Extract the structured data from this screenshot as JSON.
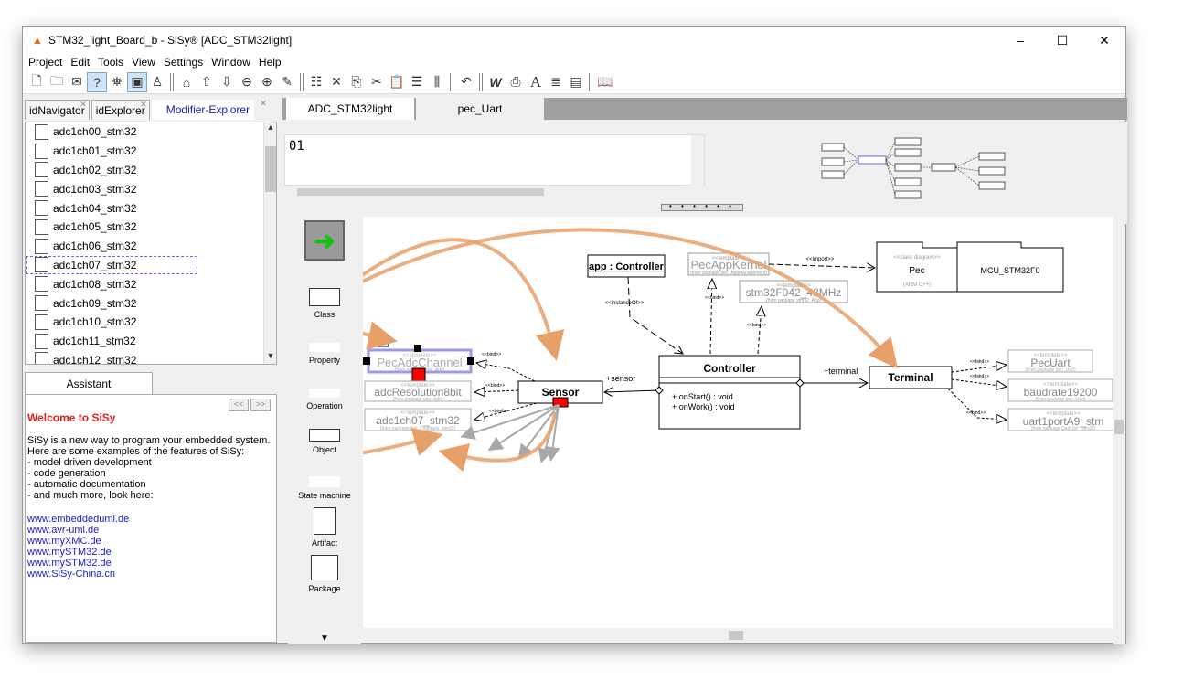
{
  "window": {
    "title": "STM32_light_Board_b - SiSy® [ADC_STM32light]"
  },
  "menu": [
    "Project",
    "Edit",
    "Tools",
    "View",
    "Settings",
    "Window",
    "Help"
  ],
  "left_tabs": [
    "idNavigator",
    "idExplorer",
    "Modifier-Explorer"
  ],
  "tree_items": [
    "adc1ch00_stm32",
    "adc1ch01_stm32",
    "adc1ch02_stm32",
    "adc1ch03_stm32",
    "adc1ch04_stm32",
    "adc1ch05_stm32",
    "adc1ch06_stm32",
    "adc1ch07_stm32",
    "adc1ch08_stm32",
    "adc1ch09_stm32",
    "adc1ch10_stm32",
    "adc1ch11_stm32",
    "adc1ch12_stm32"
  ],
  "assistant": {
    "tab": "Assistant",
    "heading": "Welcome to SiSy",
    "intro": "SiSy is a new way to program your embedded system. Here are some examples of the features of SiSy:",
    "features": [
      " - model driven development",
      " - code generation",
      " - automatic documentation",
      " - and much more, look here:"
    ],
    "links": [
      "www.embeddeduml.de",
      "www.avr-uml.de",
      "www.myXMC.de",
      "www.mySTM32.de",
      "www.mySTM32.de",
      "www.SiSy-China.cn"
    ]
  },
  "doc_tabs": [
    "ADC_STM32light",
    "pec_Uart"
  ],
  "editor": {
    "line": "01"
  },
  "palette": [
    "Class",
    "Property",
    "Operation",
    "Object",
    "State machine",
    "Artifact",
    "Package"
  ],
  "diagram": {
    "app_controller": "app : Controller",
    "pec_app_kernel": "PecAppKernel",
    "pec_app_kernel_pkg": "(from package pec_AppManagement)",
    "stm32_clock": "stm32F042_48MHz",
    "stm32_clock_pkg": "(from package stm32_App)",
    "pec_folder": "Pec",
    "pec_folder_stereo": "<<class diagram>>",
    "pec_folder_sub": "(ARM C++)",
    "mcu_folder": "MCU_STM32F0",
    "instance_of": "<<instanceOf>>",
    "import": "<<import>>",
    "bind": "<<bind>>",
    "template": "<<template>>",
    "pec_adc_channel": "PecAdcChannel",
    "pec_adc_channel_pkg": "(from package pec_Adc)",
    "adc_resolution": "adcResolution8bit",
    "adc_resolution_pkg": "(from package pec_Adc)",
    "adc_ch07": "adc1ch07_stm32",
    "adc_ch07_pkg": "(from package Adc Channels_stm32)",
    "sensor": "Sensor",
    "sensor_role": "+sensor",
    "controller": "Controller",
    "op1": "+ onStart() : void",
    "op2": "+ onWork() : void",
    "terminal_role": "+terminal",
    "terminal": "Terminal",
    "pec_uart": "PecUart",
    "pec_uart_pkg": "(from package pec_Uart)",
    "baudrate": "baudrate19200",
    "baudrate_pkg": "(from package pec_Uart)",
    "uart_port": "uart1portA9_stm",
    "uart_port_pkg": "(from package UartLibF_stm32)",
    "help_mark": "?"
  },
  "colors": {
    "accent_orange": "#e8a06a",
    "link_blue": "#1a1ad0",
    "heading_red": "#e02020",
    "selection": "#9a9ae8",
    "marker_red": "#ff0000"
  }
}
